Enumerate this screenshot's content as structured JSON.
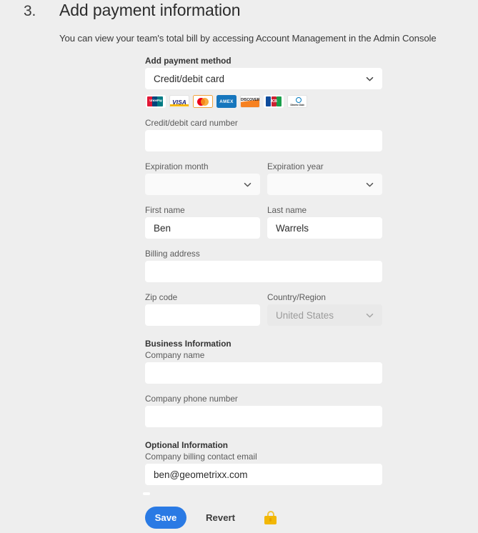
{
  "step": {
    "number": "3.",
    "title": "Add payment information",
    "description": "You can view your team's total bill by accessing Account Management in the Admin Console"
  },
  "form": {
    "payment_method": {
      "label": "Add payment method",
      "value": "Credit/debit card"
    },
    "accepted_cards": [
      {
        "name": "unionpay-logo",
        "label": "UnionPay"
      },
      {
        "name": "visa-logo",
        "label": "VISA"
      },
      {
        "name": "mastercard-logo",
        "label": ""
      },
      {
        "name": "amex-logo",
        "label": "AMEX"
      },
      {
        "name": "discover-logo",
        "label": "DISCOVER"
      },
      {
        "name": "jcb-logo",
        "label": "JCB"
      },
      {
        "name": "diners-club-logo",
        "label": "Diners Club"
      }
    ],
    "card_number": {
      "label": "Credit/debit card number",
      "value": "",
      "placeholder": ""
    },
    "expiration_month": {
      "label": "Expiration month",
      "value": ""
    },
    "expiration_year": {
      "label": "Expiration year",
      "value": ""
    },
    "first_name": {
      "label": "First name",
      "value": "Ben",
      "placeholder": ""
    },
    "last_name": {
      "label": "Last name",
      "value": "Warrels",
      "placeholder": ""
    },
    "billing_address": {
      "label": "Billing address",
      "value": "",
      "placeholder": ""
    },
    "zip_code": {
      "label": "Zip code",
      "value": "",
      "placeholder": ""
    },
    "country_region": {
      "label": "Country/Region",
      "value": "United States",
      "disabled": true
    },
    "business_information": {
      "section_label": "Business Information",
      "company_name": {
        "label": "Company name",
        "value": "",
        "placeholder": ""
      },
      "company_phone": {
        "label": "Company phone number",
        "value": "",
        "placeholder": ""
      }
    },
    "optional_information": {
      "section_label": "Optional Information",
      "billing_email": {
        "label": "Company billing contact email",
        "value": "ben@geometrixx.com",
        "placeholder": ""
      }
    }
  },
  "actions": {
    "save_label": "Save",
    "revert_label": "Revert",
    "secure_icon": "lock-icon"
  },
  "colors": {
    "background": "#eeeeee",
    "save_button": "#2a7ae4",
    "lock": "#f2b705",
    "field_background": "#ffffff",
    "disabled_field": "#e9e9e9"
  }
}
